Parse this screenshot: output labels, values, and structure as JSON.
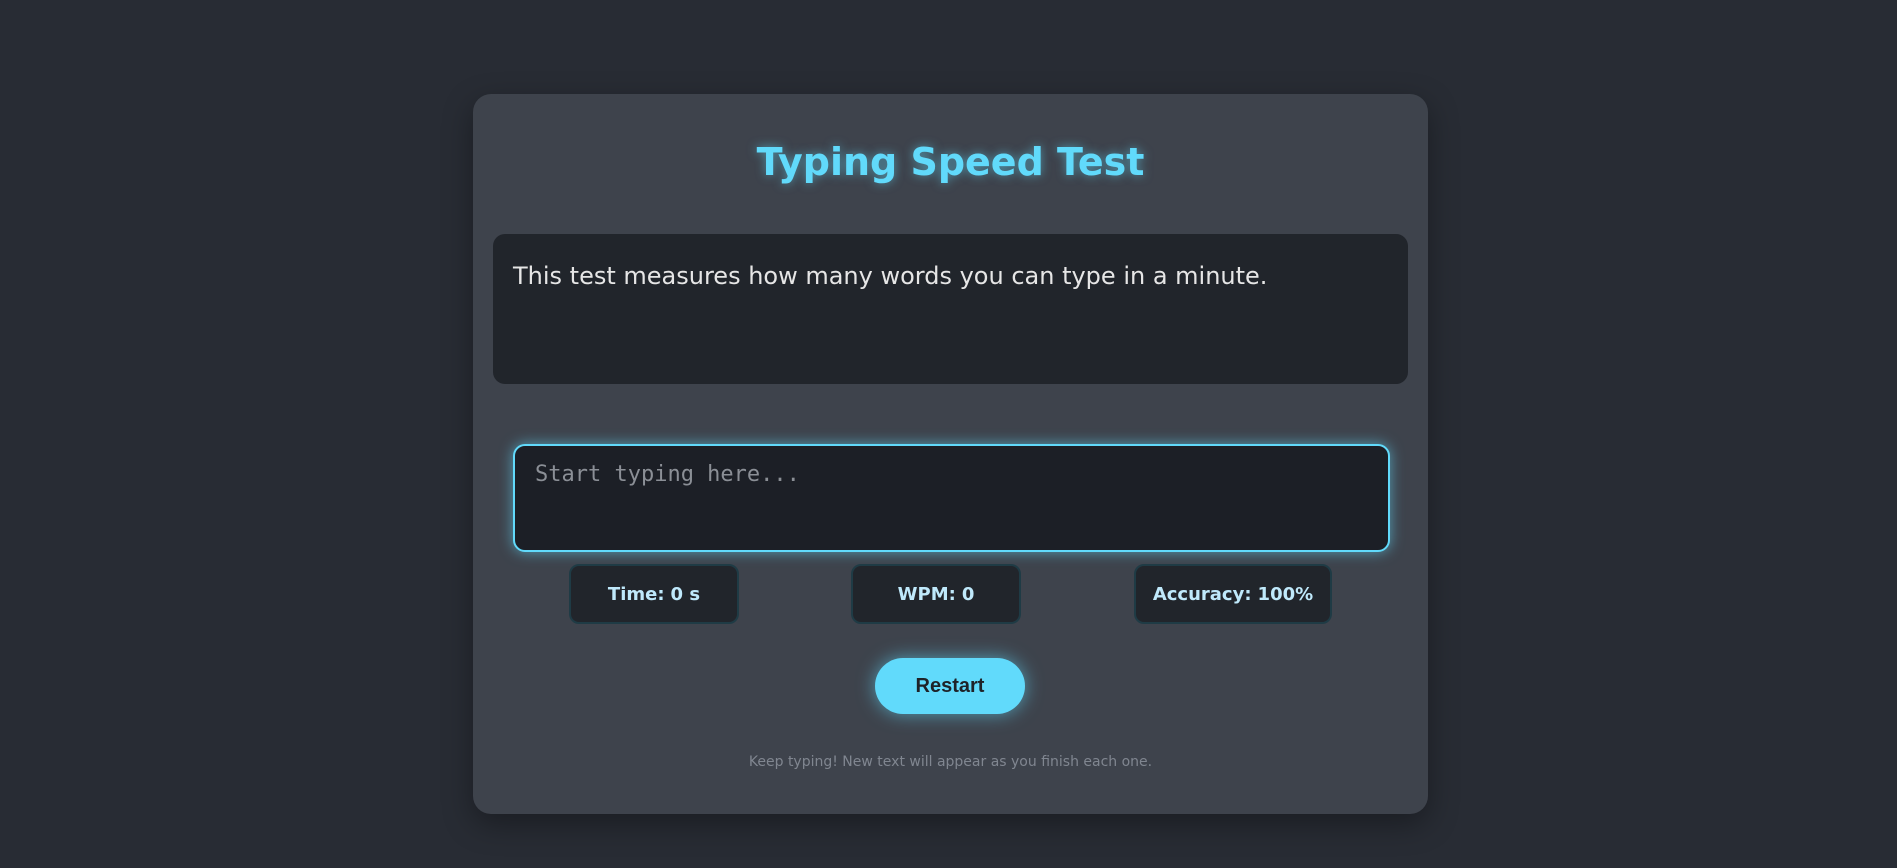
{
  "app": {
    "title": "Typing Speed Test"
  },
  "prompt": {
    "text": "This test measures how many words you can type in a minute."
  },
  "input": {
    "placeholder": "Start typing here...",
    "value": ""
  },
  "stats": {
    "time_label": "Time:",
    "time_value": "0 s",
    "wpm_label": "WPM:",
    "wpm_value": "0",
    "accuracy_label": "Accuracy:",
    "accuracy_value": "100%"
  },
  "actions": {
    "restart_label": "Restart"
  },
  "footer": {
    "note": "Keep typing! New text will appear as you finish each one."
  },
  "colors": {
    "accent": "#61dafb",
    "background": "#282c34",
    "card": "#3e434c",
    "panel": "#21252b"
  }
}
